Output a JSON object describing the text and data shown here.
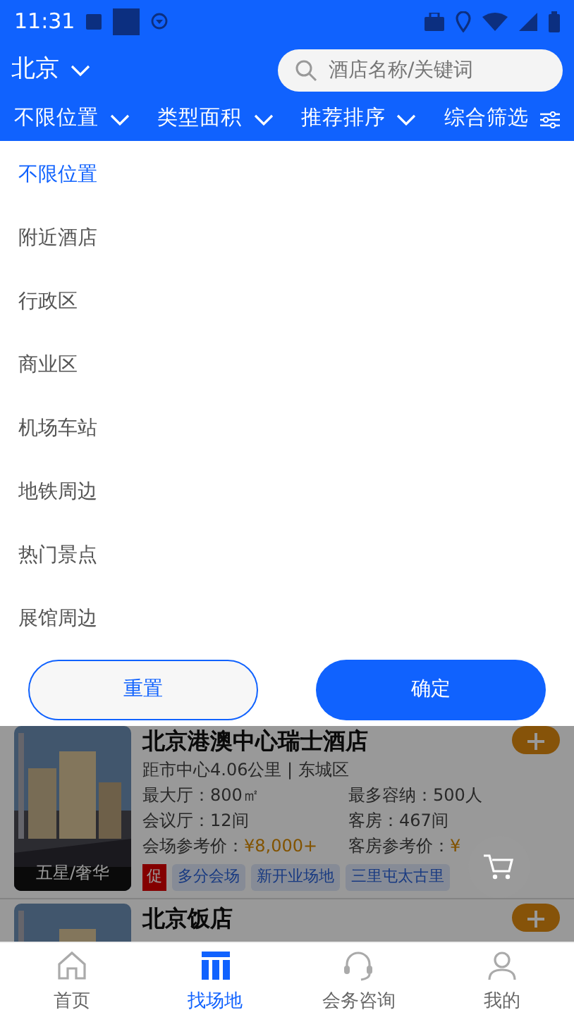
{
  "status_bar": {
    "time": "11:31"
  },
  "header": {
    "city": "北京",
    "search": {
      "placeholder": "酒店名称/关键词"
    }
  },
  "filters": [
    {
      "label": "不限位置",
      "kind": "dropdown"
    },
    {
      "label": "类型面积",
      "kind": "dropdown"
    },
    {
      "label": "推荐排序",
      "kind": "dropdown"
    },
    {
      "label": "综合筛选",
      "kind": "settings"
    }
  ],
  "dropdown": {
    "items": [
      {
        "label": "不限位置",
        "selected": true
      },
      {
        "label": "附近酒店",
        "selected": false
      },
      {
        "label": "行政区",
        "selected": false
      },
      {
        "label": "商业区",
        "selected": false
      },
      {
        "label": "机场车站",
        "selected": false
      },
      {
        "label": "地铁周边",
        "selected": false
      },
      {
        "label": "热门景点",
        "selected": false
      },
      {
        "label": "展馆周边",
        "selected": false
      }
    ],
    "buttons": [
      {
        "label": "重置",
        "kind": "outline"
      },
      {
        "label": "确定",
        "kind": "primary"
      }
    ]
  },
  "venues": [
    {
      "name": "北京港澳中心瑞士酒店",
      "rating": "五星/奢华",
      "distance": "距市中心4.06公里 | 东城区",
      "max_hall": "最大厅：800㎡",
      "capacity": "最多容纳：500人",
      "halls": "会议厅：12间",
      "rooms": "客房：467间",
      "venue_price_label": "会场参考价：",
      "venue_price": "¥8,000+",
      "room_price_label": "客房参考价：",
      "room_price": "¥",
      "promo": "促",
      "tags": [
        "多分会场",
        "新开业场地",
        "三里屯太古里"
      ]
    },
    {
      "name": "北京饭店"
    }
  ],
  "tab_bar": [
    {
      "label": "首页",
      "selected": false
    },
    {
      "label": "找场地",
      "selected": true
    },
    {
      "label": "会务咨询",
      "selected": false
    },
    {
      "label": "我的",
      "selected": false
    }
  ]
}
